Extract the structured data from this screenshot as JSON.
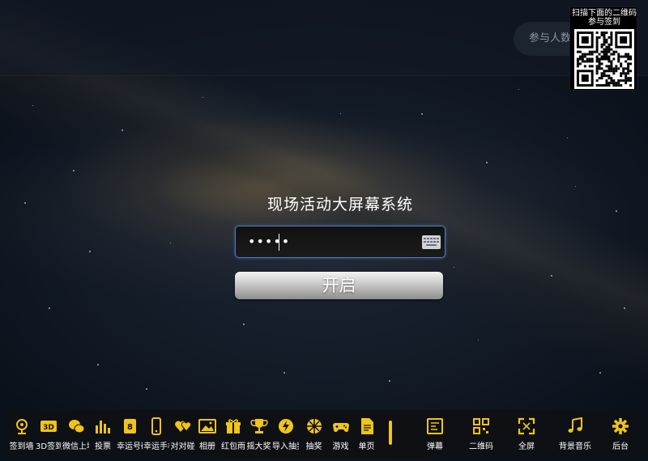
{
  "header": {
    "participant_label": "参与人数",
    "qr_caption": "扫描下面的二维码参与签到"
  },
  "login": {
    "title": "现场活动大屏幕系统",
    "password_masked": "•••••",
    "keyboard_icon": "keyboard-icon",
    "start_label": "开启"
  },
  "toolbar": {
    "accent_color": "#f0c419",
    "items": [
      {
        "label": "签到墙",
        "icon": "map-pin-icon"
      },
      {
        "label": "3D签到",
        "icon": "3d-icon"
      },
      {
        "label": "微信上墙",
        "icon": "wechat-icon"
      },
      {
        "label": "投票",
        "icon": "bar-chart-icon"
      },
      {
        "label": "幸运号码",
        "icon": "lucky-number-icon"
      },
      {
        "label": "幸运手机",
        "icon": "phone-icon"
      },
      {
        "label": "对对碰",
        "icon": "hearts-icon"
      },
      {
        "label": "相册",
        "icon": "photo-icon"
      },
      {
        "label": "红包雨",
        "icon": "gift-icon"
      },
      {
        "label": "摇大奖",
        "icon": "trophy-icon"
      },
      {
        "label": "导入抽奖",
        "icon": "import-icon"
      },
      {
        "label": "抽奖",
        "icon": "wheel-icon"
      },
      {
        "label": "游戏",
        "icon": "gamepad-icon"
      },
      {
        "label": "单页",
        "icon": "page-icon"
      },
      {
        "label": "弹幕",
        "icon": "danmaku-icon"
      },
      {
        "label": "二维码",
        "icon": "qrcode-icon"
      },
      {
        "label": "全屏",
        "icon": "fullscreen-icon"
      },
      {
        "label": "背景音乐",
        "icon": "music-icon"
      },
      {
        "label": "后台",
        "icon": "gear-icon"
      }
    ]
  }
}
